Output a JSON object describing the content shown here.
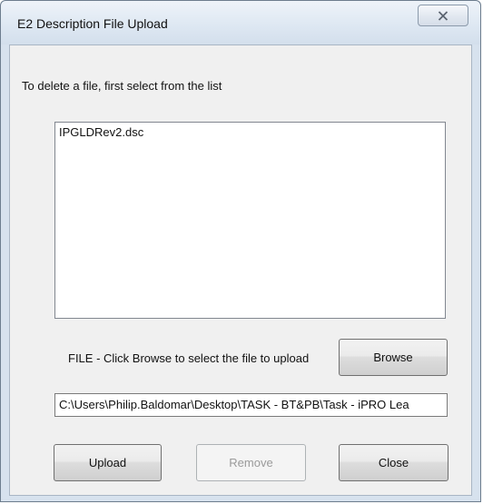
{
  "window": {
    "title": "E2 Description File Upload"
  },
  "dialog": {
    "instruction": "To delete a file, first select from the list",
    "file_list": [
      {
        "name": "IPGLDRev2.dsc"
      }
    ],
    "file_label": "FILE - Click Browse to select the file to upload",
    "file_path_value": "C:\\Users\\Philip.Baldomar\\Desktop\\TASK - BT&PB\\Task - iPRO Lea",
    "buttons": {
      "browse": "Browse",
      "upload": "Upload",
      "remove": "Remove",
      "close": "Close"
    },
    "remove_enabled": false
  },
  "colors": {
    "frame": "#d7e2ee",
    "client": "#f0f0f0",
    "disabled_text": "#9a9a9a"
  },
  "icons": {
    "close": "close-icon"
  }
}
